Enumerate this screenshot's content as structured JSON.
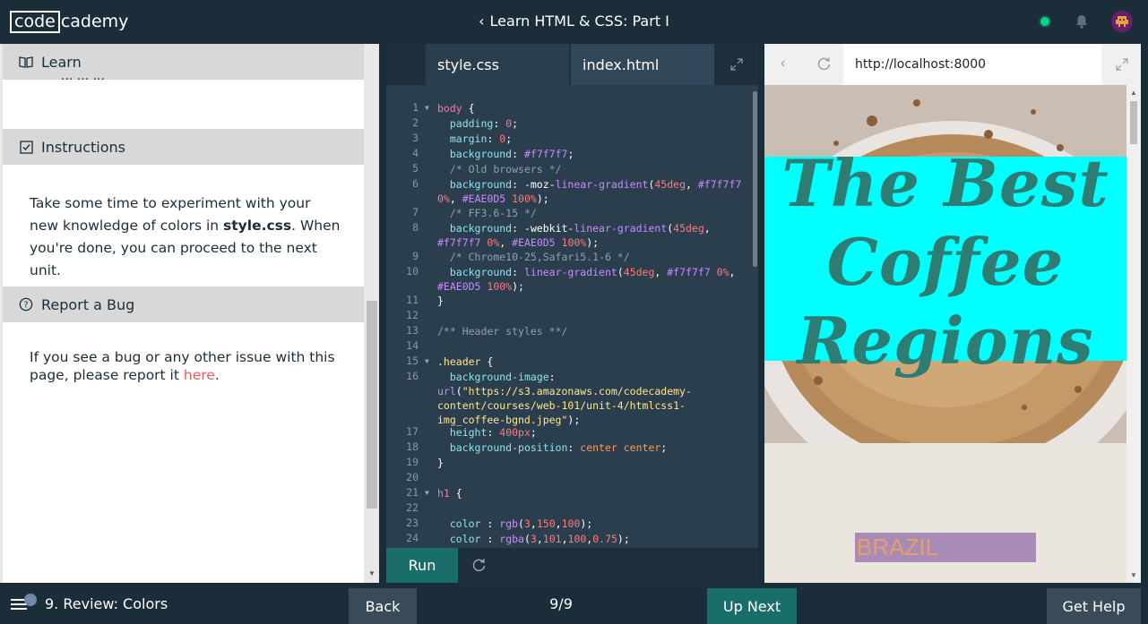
{
  "topbar": {
    "logo_box": "code",
    "logo_rest": "cademy",
    "course_title": "Learn HTML & CSS: Part I"
  },
  "left": {
    "cut_text": "... ... ...",
    "learn_label": "Learn",
    "instructions_label": "Instructions",
    "instructions_text_1": "Take some time to experiment with your new knowledge of colors in ",
    "instructions_bold": "style.css",
    "instructions_text_2": ". When you're done, you can proceed to the next unit.",
    "bug_label": "Report a Bug",
    "bug_text": "If you see a bug or any other issue with this page, please report it ",
    "bug_link": "here",
    "bug_end": "."
  },
  "editor": {
    "tabs": [
      {
        "label": "style.css"
      },
      {
        "label": "index.html"
      }
    ],
    "run_label": "Run"
  },
  "browser": {
    "url": "http://localhost:8000",
    "headline": "The Best Coffee Regions",
    "brazil": "BRAZIL"
  },
  "bottombar": {
    "lesson": "9. Review: Colors",
    "back_label": "Back",
    "pages": "9/9",
    "next_label": "Up Next",
    "help_label": "Get Help"
  },
  "colors": {
    "accent": "#1a6e6a",
    "dark": "#1c2d3a",
    "banner": "#00ffff"
  }
}
